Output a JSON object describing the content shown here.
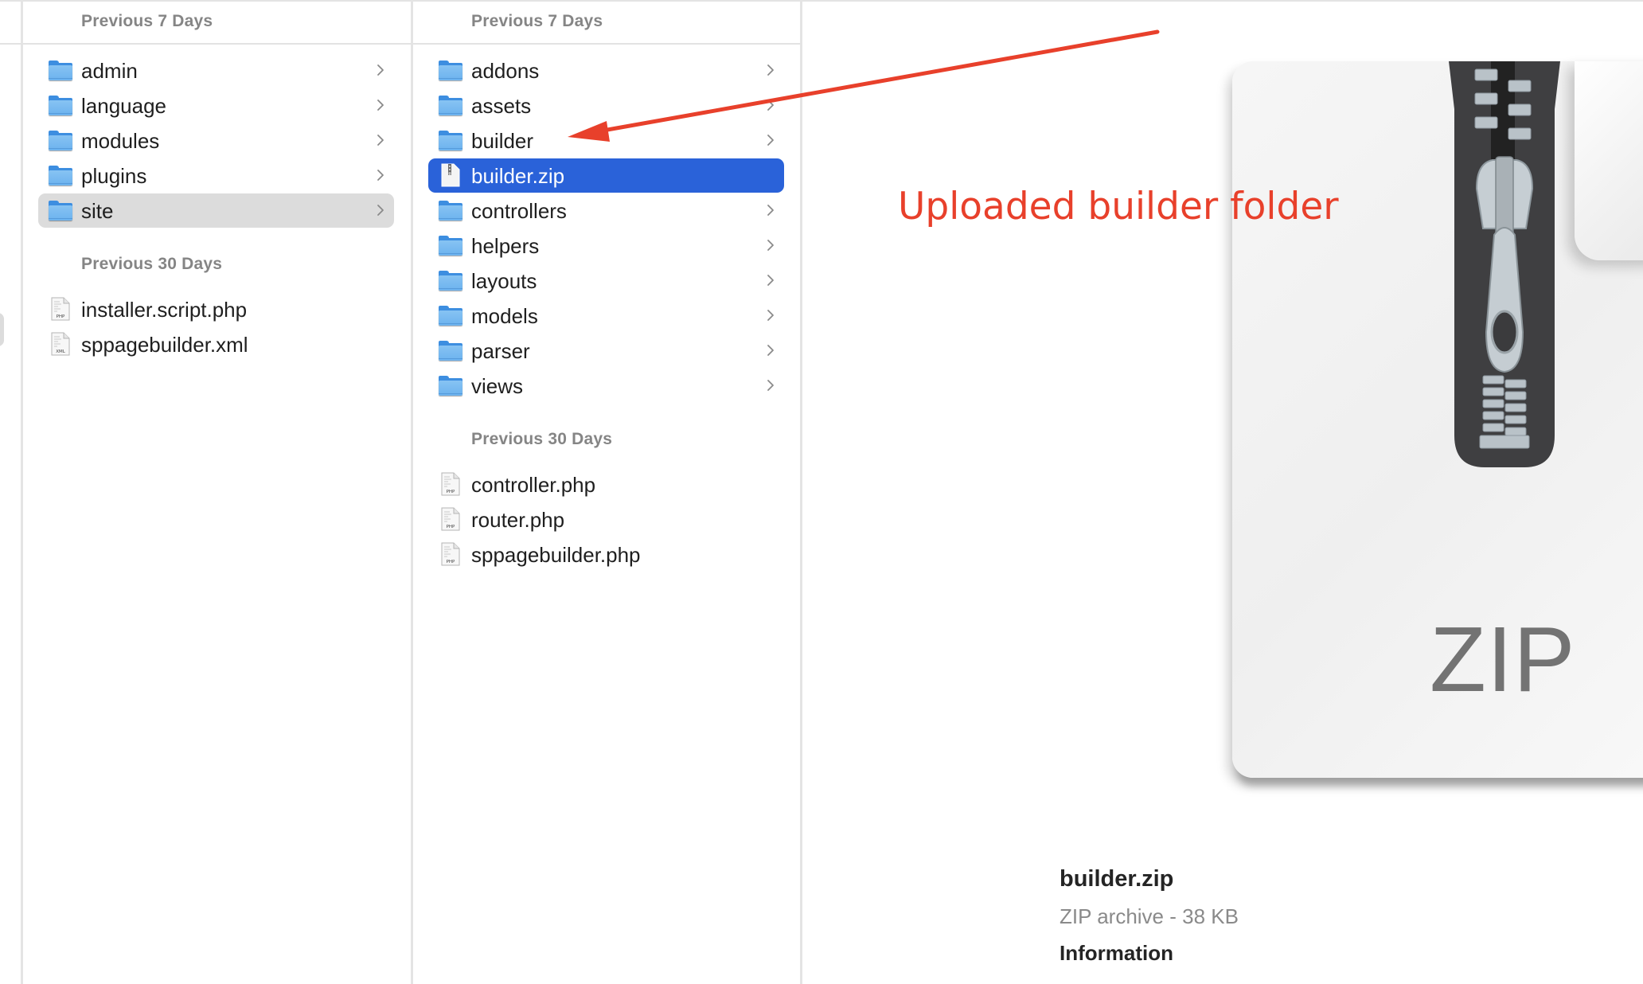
{
  "finder": {
    "columns": [
      {
        "sections": [
          {
            "title": "Previous 7 Days",
            "items": [
              {
                "name": "admin",
                "kind": "folder",
                "has_children": true,
                "state": "normal"
              },
              {
                "name": "language",
                "kind": "folder",
                "has_children": true,
                "state": "normal"
              },
              {
                "name": "modules",
                "kind": "folder",
                "has_children": true,
                "state": "normal"
              },
              {
                "name": "plugins",
                "kind": "folder",
                "has_children": true,
                "state": "normal"
              },
              {
                "name": "site",
                "kind": "folder",
                "has_children": true,
                "state": "selected-inactive"
              }
            ]
          },
          {
            "title": "Previous 30 Days",
            "items": [
              {
                "name": "installer.script.php",
                "kind": "file",
                "badge": "PHP"
              },
              {
                "name": "sppagebuilder.xml",
                "kind": "file",
                "badge": "XML"
              }
            ]
          }
        ]
      },
      {
        "sections": [
          {
            "title": "Previous 7 Days",
            "items": [
              {
                "name": "addons",
                "kind": "folder",
                "has_children": true,
                "state": "normal"
              },
              {
                "name": "assets",
                "kind": "folder",
                "has_children": true,
                "state": "normal"
              },
              {
                "name": "builder",
                "kind": "folder",
                "has_children": true,
                "state": "normal"
              },
              {
                "name": "builder.zip",
                "kind": "zip",
                "has_children": false,
                "state": "selected"
              },
              {
                "name": "controllers",
                "kind": "folder",
                "has_children": true,
                "state": "normal"
              },
              {
                "name": "helpers",
                "kind": "folder",
                "has_children": true,
                "state": "normal"
              },
              {
                "name": "layouts",
                "kind": "folder",
                "has_children": true,
                "state": "normal"
              },
              {
                "name": "models",
                "kind": "folder",
                "has_children": true,
                "state": "normal"
              },
              {
                "name": "parser",
                "kind": "folder",
                "has_children": true,
                "state": "normal"
              },
              {
                "name": "views",
                "kind": "folder",
                "has_children": true,
                "state": "normal"
              }
            ]
          },
          {
            "title": "Previous 30 Days",
            "items": [
              {
                "name": "controller.php",
                "kind": "file",
                "badge": "PHP"
              },
              {
                "name": "router.php",
                "kind": "file",
                "badge": "PHP"
              },
              {
                "name": "sppagebuilder.php",
                "kind": "file",
                "badge": "PHP"
              }
            ]
          }
        ]
      }
    ]
  },
  "preview": {
    "icon_label": "ZIP",
    "file_name": "builder.zip",
    "file_kind": "ZIP archive - 38 KB",
    "section_heading": "Information"
  },
  "annotation": {
    "text": "Uploaded builder folder",
    "color": "#e8402b",
    "points_to": "builder"
  },
  "colors": {
    "selection": "#2a62d9",
    "inactive_selection": "#dcdcdc",
    "folder": "#6cb2ee",
    "section_title": "#858585"
  }
}
